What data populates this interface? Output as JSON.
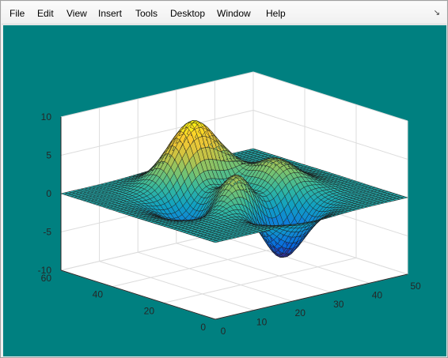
{
  "menubar": {
    "items": [
      {
        "label": "File"
      },
      {
        "label": "Edit"
      },
      {
        "label": "View"
      },
      {
        "label": "Insert"
      },
      {
        "label": "Tools"
      },
      {
        "label": "Desktop"
      },
      {
        "label": "Window"
      },
      {
        "label": "Help"
      }
    ],
    "dock_icon": "dock-arrow-icon"
  },
  "figure": {
    "background": "#008080",
    "axes_background": "#ffffff"
  },
  "chart_data": {
    "type": "surface",
    "title": "",
    "xlabel": "",
    "ylabel": "",
    "zlabel": "",
    "xlim": [
      0,
      50
    ],
    "ylim": [
      0,
      60
    ],
    "zlim": [
      -10,
      10
    ],
    "x_ticks": [
      "0",
      "10",
      "20",
      "30",
      "40",
      "50"
    ],
    "y_ticks": [
      "0",
      "20",
      "40",
      "60"
    ],
    "z_ticks": [
      "-10",
      "-5",
      "0",
      "5",
      "10"
    ],
    "grid": true,
    "colormap": "parula",
    "function": "peaks",
    "grid_size": [
      49,
      49
    ],
    "z_range": [
      -6.5,
      8.1
    ]
  }
}
